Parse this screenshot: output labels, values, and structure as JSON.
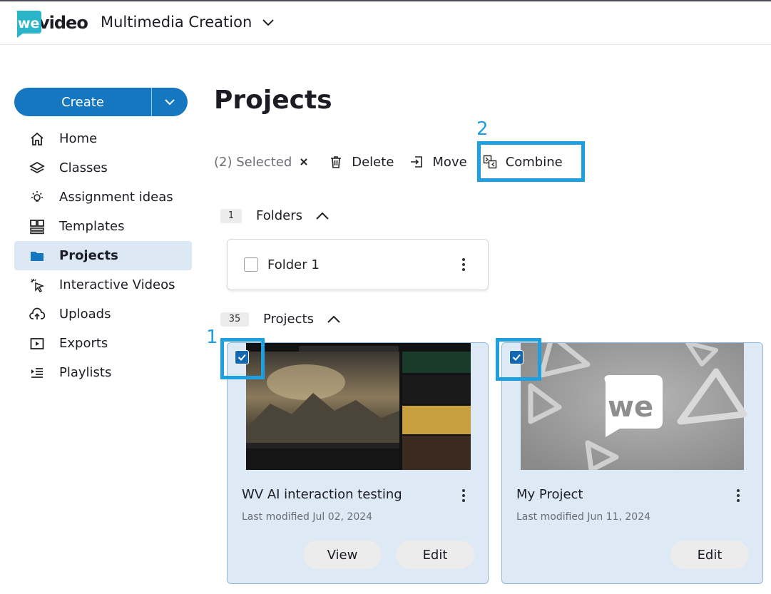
{
  "header": {
    "logo_text": "we",
    "logo_word": "video",
    "workspace": "Multimedia Creation"
  },
  "sidebar": {
    "create_label": "Create",
    "items": [
      {
        "label": "Home",
        "icon": "home-icon"
      },
      {
        "label": "Classes",
        "icon": "layers-icon"
      },
      {
        "label": "Assignment ideas",
        "icon": "lightbulb-icon"
      },
      {
        "label": "Templates",
        "icon": "templates-icon"
      },
      {
        "label": "Projects",
        "icon": "folder-icon",
        "active": true
      },
      {
        "label": "Interactive Videos",
        "icon": "cursor-click-icon"
      },
      {
        "label": "Uploads",
        "icon": "cloud-upload-icon"
      },
      {
        "label": "Exports",
        "icon": "play-box-icon"
      },
      {
        "label": "Playlists",
        "icon": "playlist-icon"
      }
    ]
  },
  "main": {
    "title": "Projects",
    "toolbar": {
      "selected": "(2) Selected",
      "delete": "Delete",
      "move": "Move",
      "combine": "Combine"
    },
    "annotations": {
      "one": "1",
      "two": "2"
    },
    "folders": {
      "count": "1",
      "label": "Folders",
      "items": [
        {
          "name": "Folder 1"
        }
      ]
    },
    "projects": {
      "count": "35",
      "label": "Projects",
      "items": [
        {
          "title": "WV AI interaction testing",
          "modified": "Last modified Jul 02, 2024",
          "view": "View",
          "edit": "Edit",
          "checked": true
        },
        {
          "title": "My Project",
          "modified": "Last modified Jun 11, 2024",
          "edit": "Edit",
          "checked": true
        }
      ]
    }
  },
  "colors": {
    "accent": "#1477c0",
    "annotation": "#1e9fe0",
    "active_nav_bg": "#dce9f5",
    "card_bg": "#dde9f4"
  }
}
